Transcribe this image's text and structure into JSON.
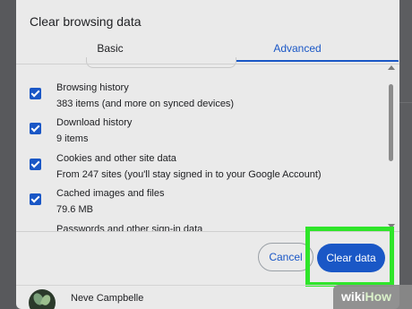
{
  "dialog": {
    "title": "Clear browsing data",
    "tabs": [
      {
        "label": "Basic"
      },
      {
        "label": "Advanced"
      }
    ],
    "items": [
      {
        "title": "Browsing history",
        "subtitle": "383 items (and more on synced devices)",
        "checked": true
      },
      {
        "title": "Download history",
        "subtitle": "9 items",
        "checked": true
      },
      {
        "title": "Cookies and other site data",
        "subtitle": "From 247 sites (you'll stay signed in to your Google Account)",
        "checked": true
      },
      {
        "title": "Cached images and files",
        "subtitle": "79.6 MB",
        "checked": true
      },
      {
        "title": "Passwords and other sign-in data"
      }
    ],
    "cancel_label": "Cancel",
    "clear_label": "Clear data",
    "accent_color": "#1a57c6",
    "highlight_color": "#2fe52a"
  },
  "profile": {
    "name": "Neve Campbelle"
  },
  "watermark": {
    "wiki": "wiki",
    "how": "How"
  }
}
